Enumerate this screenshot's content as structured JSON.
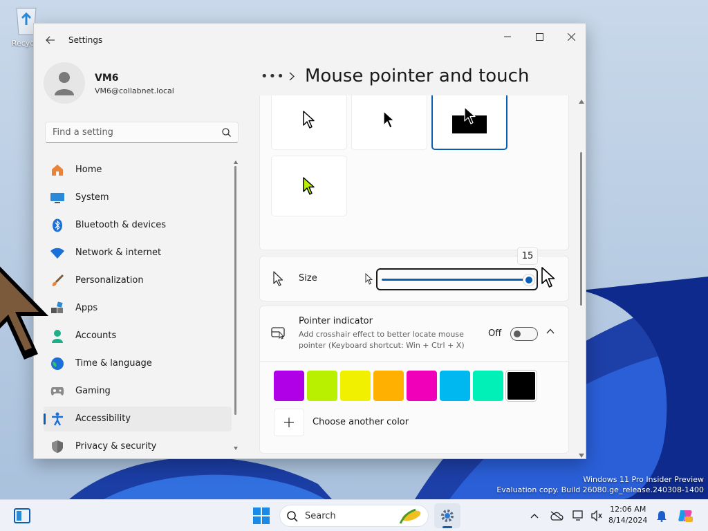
{
  "desktop": {
    "recycle_bin_label": "Recycle",
    "watermark_line1": "Windows 11 Pro Insider Preview",
    "watermark_line2": "Evaluation copy. Build 26080.ge_release.240308-1400"
  },
  "window": {
    "app_title": "Settings"
  },
  "profile": {
    "name": "VM6",
    "email": "VM6@collabnet.local"
  },
  "search": {
    "placeholder": "Find a setting"
  },
  "nav": {
    "items": [
      {
        "label": "Home",
        "icon": "home-icon"
      },
      {
        "label": "System",
        "icon": "system-icon"
      },
      {
        "label": "Bluetooth & devices",
        "icon": "bluetooth-icon"
      },
      {
        "label": "Network & internet",
        "icon": "wifi-icon"
      },
      {
        "label": "Personalization",
        "icon": "brush-icon"
      },
      {
        "label": "Apps",
        "icon": "apps-icon"
      },
      {
        "label": "Accounts",
        "icon": "accounts-icon"
      },
      {
        "label": "Time & language",
        "icon": "globe-icon"
      },
      {
        "label": "Gaming",
        "icon": "gamepad-icon"
      },
      {
        "label": "Accessibility",
        "icon": "accessibility-icon",
        "active": true
      },
      {
        "label": "Privacy & security",
        "icon": "shield-icon"
      }
    ]
  },
  "breadcrumb": {
    "dots": "•••",
    "title": "Mouse pointer and touch"
  },
  "size": {
    "label": "Size",
    "value": "15"
  },
  "pointer_indicator": {
    "title": "Pointer indicator",
    "description": "Add crosshair effect to better locate mouse pointer (Keyboard shortcut: Win + Ctrl + X)",
    "state": "Off"
  },
  "colors": {
    "swatches": [
      "#b000e8",
      "#b8f000",
      "#f0f000",
      "#ffb000",
      "#f000b8",
      "#00b8f0",
      "#00f0b8",
      "#000000"
    ],
    "add_label": "Choose another color"
  },
  "taskbar": {
    "search_label": "Search",
    "time": "12:06 AM",
    "date": "8/14/2024"
  },
  "accent": "#0a5fb4"
}
